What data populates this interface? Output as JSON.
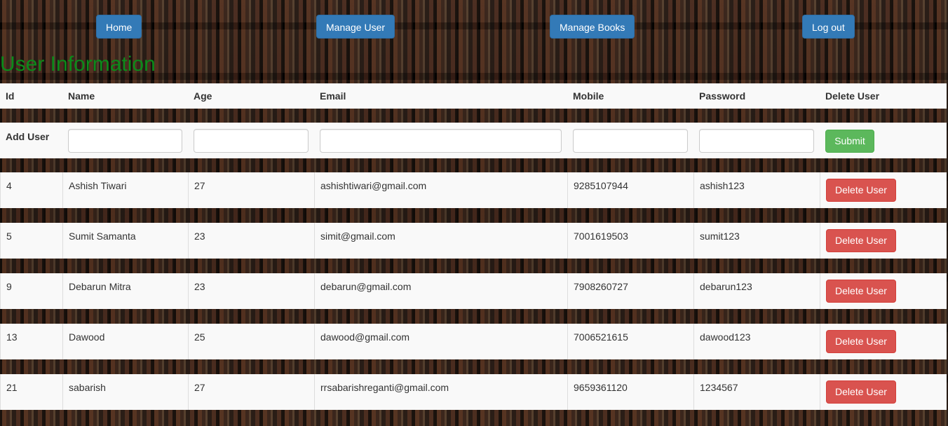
{
  "nav": {
    "home_label": "Home",
    "manage_user_label": "Manage User",
    "manage_books_label": "Manage Books",
    "logout_label": "Log out"
  },
  "page": {
    "title": "User Information"
  },
  "table": {
    "headers": [
      "Id",
      "Name",
      "Age",
      "Email",
      "Mobile",
      "Password",
      "Delete User"
    ],
    "add_row": {
      "label": "Add User",
      "inputs": {
        "name": "",
        "age": "",
        "email": "",
        "mobile": "",
        "password": ""
      },
      "submit_label": "Submit"
    },
    "delete_label": "Delete User",
    "rows": [
      {
        "id": "4",
        "name": "Ashish Tiwari",
        "age": "27",
        "email": "ashishtiwari@gmail.com",
        "mobile": "9285107944",
        "password": "ashish123"
      },
      {
        "id": "5",
        "name": "Sumit Samanta",
        "age": "23",
        "email": "simit@gmail.com",
        "mobile": "7001619503",
        "password": "sumit123"
      },
      {
        "id": "9",
        "name": "Debarun Mitra",
        "age": "23",
        "email": "debarun@gmail.com",
        "mobile": "7908260727",
        "password": "debarun123"
      },
      {
        "id": "13",
        "name": "Dawood",
        "age": "25",
        "email": "dawood@gmail.com",
        "mobile": "7006521615",
        "password": "dawood123"
      },
      {
        "id": "21",
        "name": "sabarish",
        "age": "27",
        "email": "rrsabarishreganti@gmail.com",
        "mobile": "9659361120",
        "password": "1234567"
      }
    ]
  },
  "colors": {
    "nav_button": "#337ab7",
    "title": "#0c8a1a",
    "submit_button": "#5cb85c",
    "delete_button": "#d9534f"
  }
}
